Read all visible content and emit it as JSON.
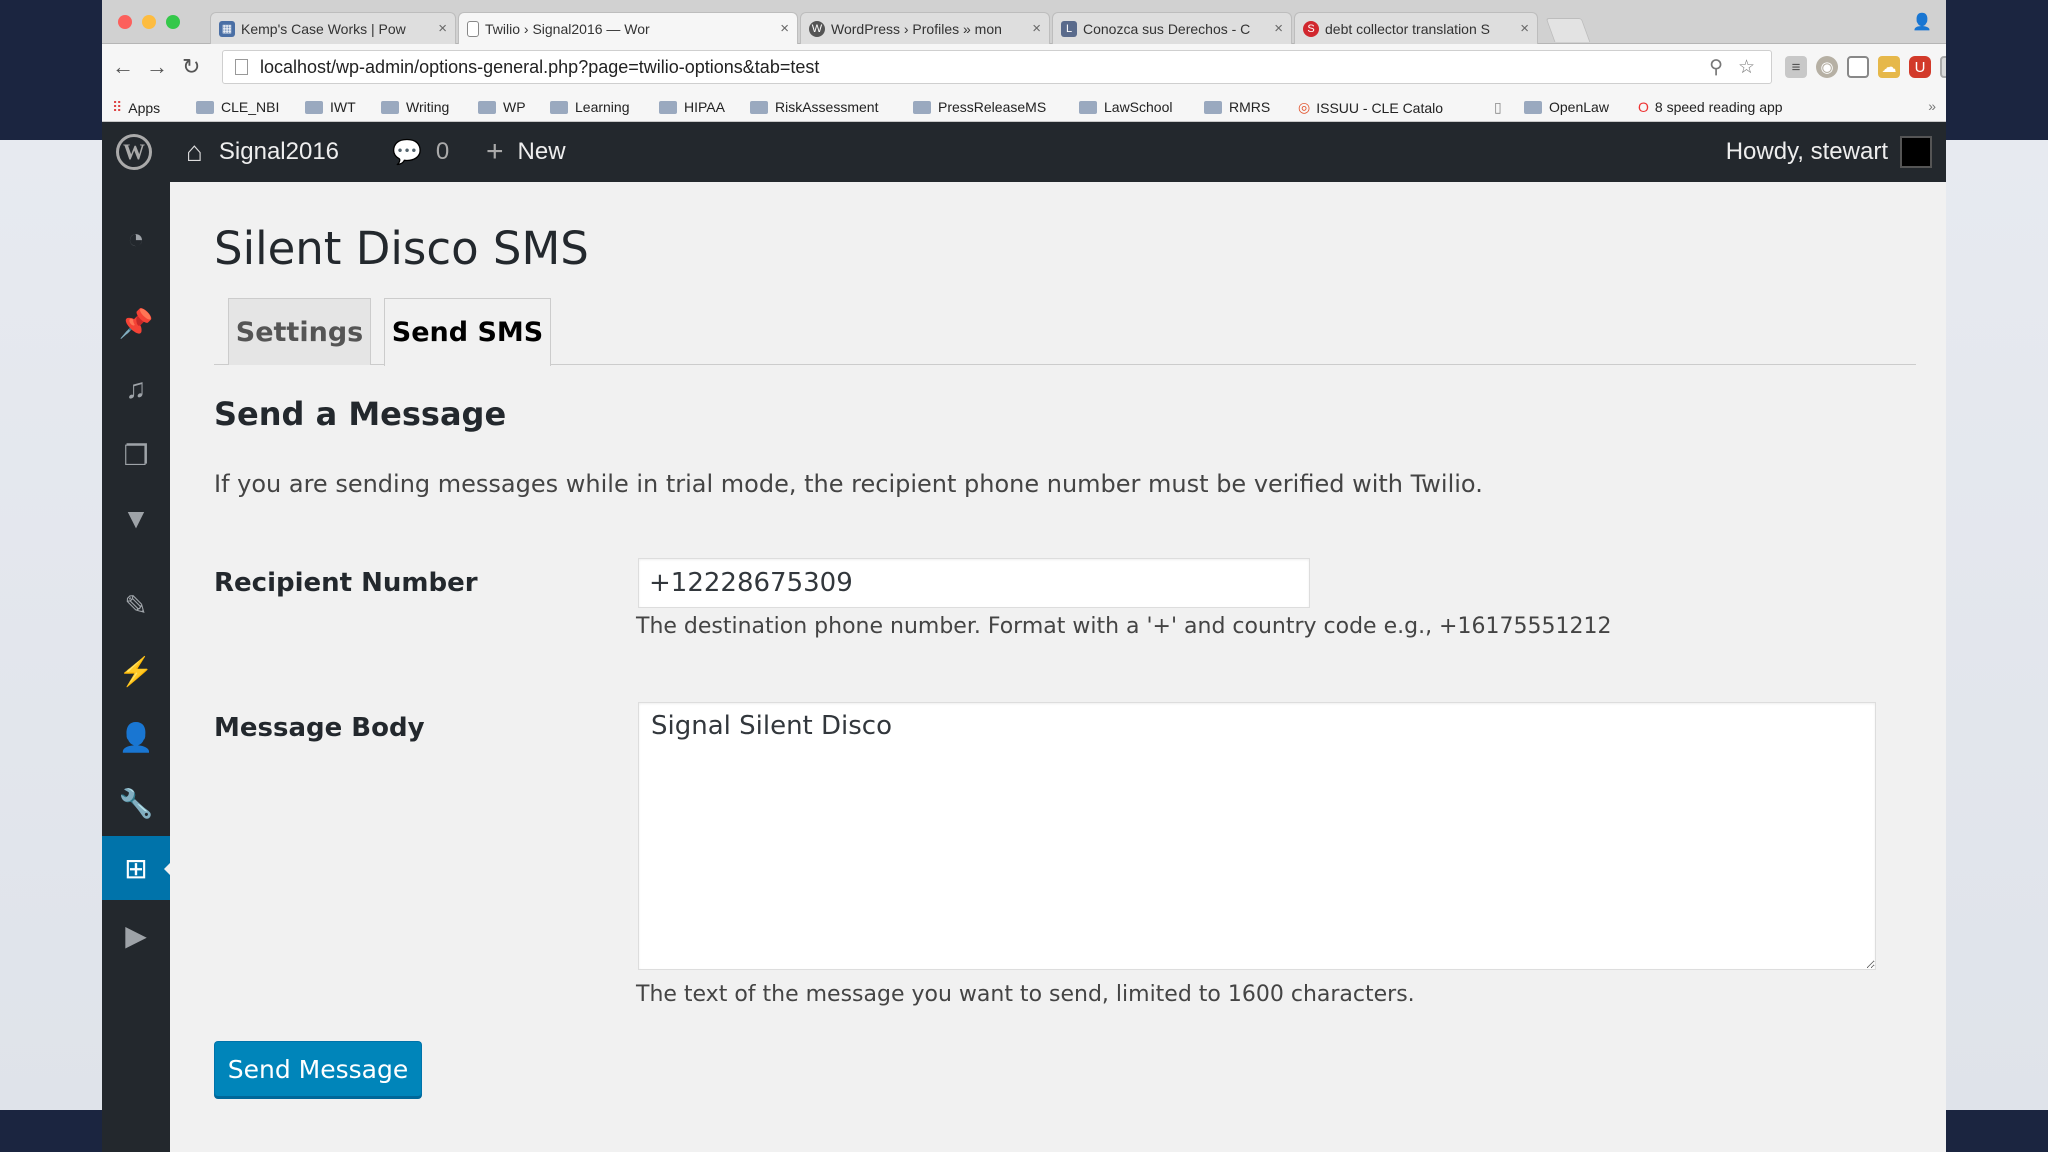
{
  "browser": {
    "tabs": [
      {
        "title": "Kemp's Case Works | Pow",
        "icon": "grid-icon",
        "color": "#4a6fa5"
      },
      {
        "title": "Twilio › Signal2016 — Wor",
        "icon": "page-icon",
        "color": "#888888"
      },
      {
        "title": "WordPress › Profiles » mon",
        "icon": "wordpress-icon",
        "color": "#555555"
      },
      {
        "title": "Conozca sus Derechos - C",
        "icon": "lh-icon",
        "color": "#5a6b8c"
      },
      {
        "title": "debt collector translation S",
        "icon": "translate-icon",
        "color": "#d1272e"
      }
    ],
    "url": "localhost/wp-admin/options-general.php?page=twilio-options&tab=test",
    "bookmarks": [
      "Apps",
      "CLE_NBI",
      "IWT",
      "Writing",
      "WP",
      "Learning",
      "HIPAA",
      "RiskAssessment",
      "PressReleaseMS",
      "LawSchool",
      "RMRS",
      "ISSUU - CLE Catalo",
      "OpenLaw",
      "8 speed reading app"
    ],
    "more": "»"
  },
  "adminbar": {
    "site_name": "Signal2016",
    "comments_count": "0",
    "new_label": "New",
    "howdy": "Howdy, stewart"
  },
  "sidebar": {
    "icons": [
      "dashboard-icon",
      "posts-pin-icon",
      "media-icon",
      "pages-icon",
      "comments-icon",
      "appearance-icon",
      "plugins-icon",
      "users-icon",
      "tools-icon",
      "settings-icon",
      "play-icon"
    ],
    "active": "settings-icon"
  },
  "page": {
    "title": "Silent Disco SMS",
    "tabs": [
      "Settings",
      "Send SMS"
    ],
    "active_tab": "Send SMS",
    "section_title": "Send a Message",
    "intro": "If you are sending messages while in trial mode, the recipient phone number must be verified with Twilio.",
    "recipient_label": "Recipient Number",
    "recipient_value": "+12228675309",
    "recipient_desc": "The destination phone number. Format with a '+' and country code e.g., +16175551212",
    "body_label": "Message Body",
    "body_value": "Signal Silent Disco",
    "body_desc": "The text of the message you want to send, limited to 1600 characters.",
    "send_label": "Send Message"
  },
  "colors": {
    "wp_dark": "#23282d",
    "wp_blue": "#0073aa",
    "button_blue": "#0085ba"
  }
}
